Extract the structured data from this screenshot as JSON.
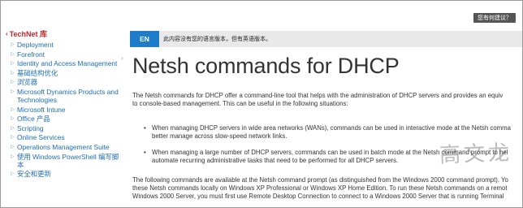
{
  "header": {
    "help_label": "您有何建议？"
  },
  "sidebar": {
    "title": "TechNet 库",
    "items": [
      {
        "label": "Deployment"
      },
      {
        "label": "Forefront"
      },
      {
        "label": "Identity and Access Management"
      },
      {
        "label": "基础结构优化"
      },
      {
        "label": "浏览器"
      },
      {
        "label": "Microsoft Dynamics Products and Technologies"
      },
      {
        "label": "Microsoft Intune"
      },
      {
        "label": "Office 产品"
      },
      {
        "label": "Scripting"
      },
      {
        "label": "Online Services"
      },
      {
        "label": "Operations Management Suite"
      },
      {
        "label": "使用 Windows PowerShell 编写脚本"
      },
      {
        "label": "安全和更新"
      }
    ]
  },
  "language": {
    "button": "EN",
    "note": "此内容没有您的语言版本，但有英语版本。"
  },
  "article": {
    "title": "Netsh commands for DHCP",
    "intro_line1": "The Netsh commands for DHCP offer a command-line tool that helps with the administration of DHCP servers and provides an equiv",
    "intro_line2": "to console-based management. This can be useful in the following situations:",
    "bullet1_line1": "When managing DHCP servers in wide area networks (WANs), commands can be used in interactive mode at the Netsh comma",
    "bullet1_line2": "better manage across slow-speed network links.",
    "bullet2_line1": "When managing a large number of DHCP servers, commands can be used in batch mode at the Netsh command prompt to hel",
    "bullet2_line2": "automate recurring administrative tasks that need to be performed for all DHCP servers.",
    "outro_line1": "The following commands are available at the Netsh command prompt (as distinguished from the Windows 2000 command prompt). Yo",
    "outro_line2": "these Netsh commands locally on Windows XP Professional or Windows XP Home Edition. To run these Netsh commands on a remot",
    "outro_line3": "Windows 2000 Server, you must first use Remote Desktop Connection to connect to a Windows 2000 Server that is running Terminal"
  },
  "watermark": "高文龙",
  "colors": {
    "accent": "#1f7cc8",
    "sidebar_title": "#c1272d",
    "link": "#1e6db4"
  }
}
